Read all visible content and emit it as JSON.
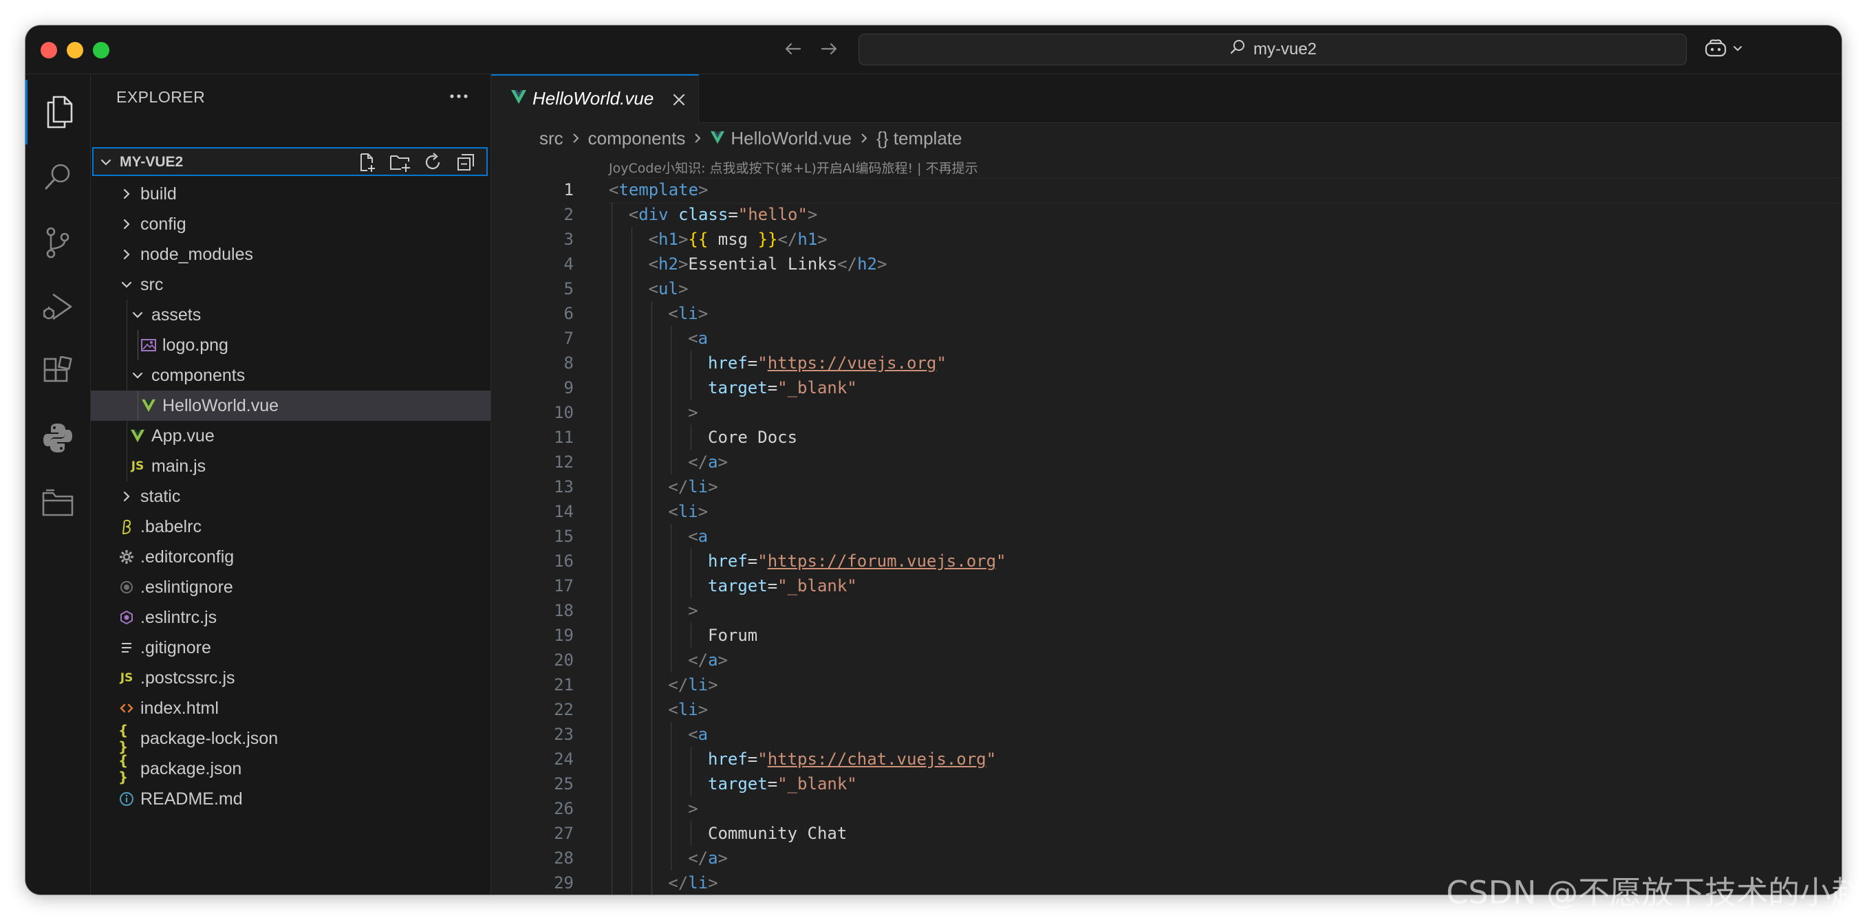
{
  "titlebar": {
    "command_center_text": "my-vue2",
    "icons": {
      "back": "arrow-left-icon",
      "forward": "arrow-right-icon",
      "search": "search-icon",
      "copilot": "copilot-icon"
    }
  },
  "activity_bar": {
    "items": [
      {
        "icon": "explorer-icon",
        "active": true
      },
      {
        "icon": "search-icon"
      },
      {
        "icon": "source-control-icon"
      },
      {
        "icon": "run-debug-icon"
      },
      {
        "icon": "extensions-icon"
      },
      {
        "icon": "python-icon"
      },
      {
        "icon": "folder-icon"
      }
    ]
  },
  "sidebar": {
    "title": "EXPLORER",
    "more_label": "···",
    "root": {
      "label": "MY-VUE2",
      "actions": [
        "new-file-icon",
        "new-folder-icon",
        "refresh-icon",
        "collapse-all-icon"
      ]
    },
    "tree": [
      {
        "label": "build",
        "type": "folder",
        "expanded": false,
        "depth": 0
      },
      {
        "label": "config",
        "type": "folder",
        "expanded": false,
        "depth": 0
      },
      {
        "label": "node_modules",
        "type": "folder",
        "expanded": false,
        "depth": 0
      },
      {
        "label": "src",
        "type": "folder",
        "expanded": true,
        "depth": 0
      },
      {
        "label": "assets",
        "type": "folder",
        "expanded": true,
        "depth": 1
      },
      {
        "label": "logo.png",
        "type": "file",
        "icon": "image-file-icon",
        "depth": 2
      },
      {
        "label": "components",
        "type": "folder",
        "expanded": true,
        "depth": 1
      },
      {
        "label": "HelloWorld.vue",
        "type": "file",
        "icon": "vue-file-icon",
        "depth": 2,
        "selected": true
      },
      {
        "label": "App.vue",
        "type": "file",
        "icon": "vue-file-icon",
        "depth": 1
      },
      {
        "label": "main.js",
        "type": "file",
        "icon": "js-file-icon",
        "depth": 1
      },
      {
        "label": "static",
        "type": "folder",
        "expanded": false,
        "depth": 0
      },
      {
        "label": ".babelrc",
        "type": "file",
        "icon": "babel-file-icon",
        "depth": 0
      },
      {
        "label": ".editorconfig",
        "type": "file",
        "icon": "gear-file-icon",
        "depth": 0
      },
      {
        "label": ".eslintignore",
        "type": "file",
        "icon": "eslint-ignore-icon",
        "depth": 0
      },
      {
        "label": ".eslintrc.js",
        "type": "file",
        "icon": "eslint-file-icon",
        "depth": 0
      },
      {
        "label": ".gitignore",
        "type": "file",
        "icon": "lines-file-icon",
        "depth": 0
      },
      {
        "label": ".postcssrc.js",
        "type": "file",
        "icon": "js-file-icon",
        "depth": 0
      },
      {
        "label": "index.html",
        "type": "file",
        "icon": "html-file-icon",
        "depth": 0
      },
      {
        "label": "package-lock.json",
        "type": "file",
        "icon": "json-file-icon",
        "depth": 0
      },
      {
        "label": "package.json",
        "type": "file",
        "icon": "json-file-icon",
        "depth": 0
      },
      {
        "label": "README.md",
        "type": "file",
        "icon": "info-file-icon",
        "depth": 0
      }
    ],
    "glyphs": {
      "js": "JS",
      "json": "{ }"
    }
  },
  "editor": {
    "tab": {
      "label": "HelloWorld.vue",
      "close_glyph": "✕"
    },
    "breadcrumb": [
      "src",
      "components",
      "HelloWorld.vue",
      "{} template"
    ],
    "hint": "JoyCode小知识: 点我或按下(⌘+L)开启AI编码旅程! | 不再提示",
    "active_line": 1,
    "lines": [
      {
        "n": 1,
        "indent": 0,
        "tokens": [
          [
            "b",
            "<"
          ],
          [
            "tag",
            "template"
          ],
          [
            "b",
            ">"
          ]
        ]
      },
      {
        "n": 2,
        "indent": 1,
        "tokens": [
          [
            "b",
            "<"
          ],
          [
            "tag",
            "div"
          ],
          [
            "txt",
            " "
          ],
          [
            "attr",
            "class"
          ],
          [
            "txt",
            "="
          ],
          [
            "str",
            "\"hello\""
          ],
          [
            "b",
            ">"
          ]
        ]
      },
      {
        "n": 3,
        "indent": 2,
        "tokens": [
          [
            "b",
            "<"
          ],
          [
            "tag",
            "h1"
          ],
          [
            "b",
            ">"
          ],
          [
            "mus",
            "{{"
          ],
          [
            "txt",
            " msg "
          ],
          [
            "mus",
            "}}"
          ],
          [
            "b",
            "</"
          ],
          [
            "tag",
            "h1"
          ],
          [
            "b",
            ">"
          ]
        ]
      },
      {
        "n": 4,
        "indent": 2,
        "tokens": [
          [
            "b",
            "<"
          ],
          [
            "tag",
            "h2"
          ],
          [
            "b",
            ">"
          ],
          [
            "txt",
            "Essential Links"
          ],
          [
            "b",
            "</"
          ],
          [
            "tag",
            "h2"
          ],
          [
            "b",
            ">"
          ]
        ]
      },
      {
        "n": 5,
        "indent": 2,
        "tokens": [
          [
            "b",
            "<"
          ],
          [
            "tag",
            "ul"
          ],
          [
            "b",
            ">"
          ]
        ]
      },
      {
        "n": 6,
        "indent": 3,
        "tokens": [
          [
            "b",
            "<"
          ],
          [
            "tag",
            "li"
          ],
          [
            "b",
            ">"
          ]
        ]
      },
      {
        "n": 7,
        "indent": 4,
        "tokens": [
          [
            "b",
            "<"
          ],
          [
            "tag",
            "a"
          ]
        ]
      },
      {
        "n": 8,
        "indent": 5,
        "tokens": [
          [
            "attr",
            "href"
          ],
          [
            "txt",
            "="
          ],
          [
            "str",
            "\""
          ],
          [
            "url",
            "https://vuejs.org"
          ],
          [
            "str",
            "\""
          ]
        ]
      },
      {
        "n": 9,
        "indent": 5,
        "tokens": [
          [
            "attr",
            "target"
          ],
          [
            "txt",
            "="
          ],
          [
            "str",
            "\"_blank\""
          ]
        ]
      },
      {
        "n": 10,
        "indent": 4,
        "tokens": [
          [
            "b",
            ">"
          ]
        ]
      },
      {
        "n": 11,
        "indent": 5,
        "tokens": [
          [
            "txt",
            "Core Docs"
          ]
        ]
      },
      {
        "n": 12,
        "indent": 4,
        "tokens": [
          [
            "b",
            "</"
          ],
          [
            "tag",
            "a"
          ],
          [
            "b",
            ">"
          ]
        ]
      },
      {
        "n": 13,
        "indent": 3,
        "tokens": [
          [
            "b",
            "</"
          ],
          [
            "tag",
            "li"
          ],
          [
            "b",
            ">"
          ]
        ]
      },
      {
        "n": 14,
        "indent": 3,
        "tokens": [
          [
            "b",
            "<"
          ],
          [
            "tag",
            "li"
          ],
          [
            "b",
            ">"
          ]
        ]
      },
      {
        "n": 15,
        "indent": 4,
        "tokens": [
          [
            "b",
            "<"
          ],
          [
            "tag",
            "a"
          ]
        ]
      },
      {
        "n": 16,
        "indent": 5,
        "tokens": [
          [
            "attr",
            "href"
          ],
          [
            "txt",
            "="
          ],
          [
            "str",
            "\""
          ],
          [
            "url",
            "https://forum.vuejs.org"
          ],
          [
            "str",
            "\""
          ]
        ]
      },
      {
        "n": 17,
        "indent": 5,
        "tokens": [
          [
            "attr",
            "target"
          ],
          [
            "txt",
            "="
          ],
          [
            "str",
            "\"_blank\""
          ]
        ]
      },
      {
        "n": 18,
        "indent": 4,
        "tokens": [
          [
            "b",
            ">"
          ]
        ]
      },
      {
        "n": 19,
        "indent": 5,
        "tokens": [
          [
            "txt",
            "Forum"
          ]
        ]
      },
      {
        "n": 20,
        "indent": 4,
        "tokens": [
          [
            "b",
            "</"
          ],
          [
            "tag",
            "a"
          ],
          [
            "b",
            ">"
          ]
        ]
      },
      {
        "n": 21,
        "indent": 3,
        "tokens": [
          [
            "b",
            "</"
          ],
          [
            "tag",
            "li"
          ],
          [
            "b",
            ">"
          ]
        ]
      },
      {
        "n": 22,
        "indent": 3,
        "tokens": [
          [
            "b",
            "<"
          ],
          [
            "tag",
            "li"
          ],
          [
            "b",
            ">"
          ]
        ]
      },
      {
        "n": 23,
        "indent": 4,
        "tokens": [
          [
            "b",
            "<"
          ],
          [
            "tag",
            "a"
          ]
        ]
      },
      {
        "n": 24,
        "indent": 5,
        "tokens": [
          [
            "attr",
            "href"
          ],
          [
            "txt",
            "="
          ],
          [
            "str",
            "\""
          ],
          [
            "url",
            "https://chat.vuejs.org"
          ],
          [
            "str",
            "\""
          ]
        ]
      },
      {
        "n": 25,
        "indent": 5,
        "tokens": [
          [
            "attr",
            "target"
          ],
          [
            "txt",
            "="
          ],
          [
            "str",
            "\"_blank\""
          ]
        ]
      },
      {
        "n": 26,
        "indent": 4,
        "tokens": [
          [
            "b",
            ">"
          ]
        ]
      },
      {
        "n": 27,
        "indent": 5,
        "tokens": [
          [
            "txt",
            "Community Chat"
          ]
        ]
      },
      {
        "n": 28,
        "indent": 4,
        "tokens": [
          [
            "b",
            "</"
          ],
          [
            "tag",
            "a"
          ],
          [
            "b",
            ">"
          ]
        ]
      },
      {
        "n": 29,
        "indent": 3,
        "tokens": [
          [
            "b",
            "</"
          ],
          [
            "tag",
            "li"
          ],
          [
            "b",
            ">"
          ]
        ]
      }
    ]
  },
  "watermark": "CSDN @不愿放下技术的小赵",
  "colors": {
    "accent": "#0078d4",
    "vue_green": "#41b883",
    "js_yellow": "#cbcb41",
    "tag": "#569cd6",
    "attr": "#9cdcfe",
    "string": "#ce9178",
    "mustache": "#ffd700"
  }
}
